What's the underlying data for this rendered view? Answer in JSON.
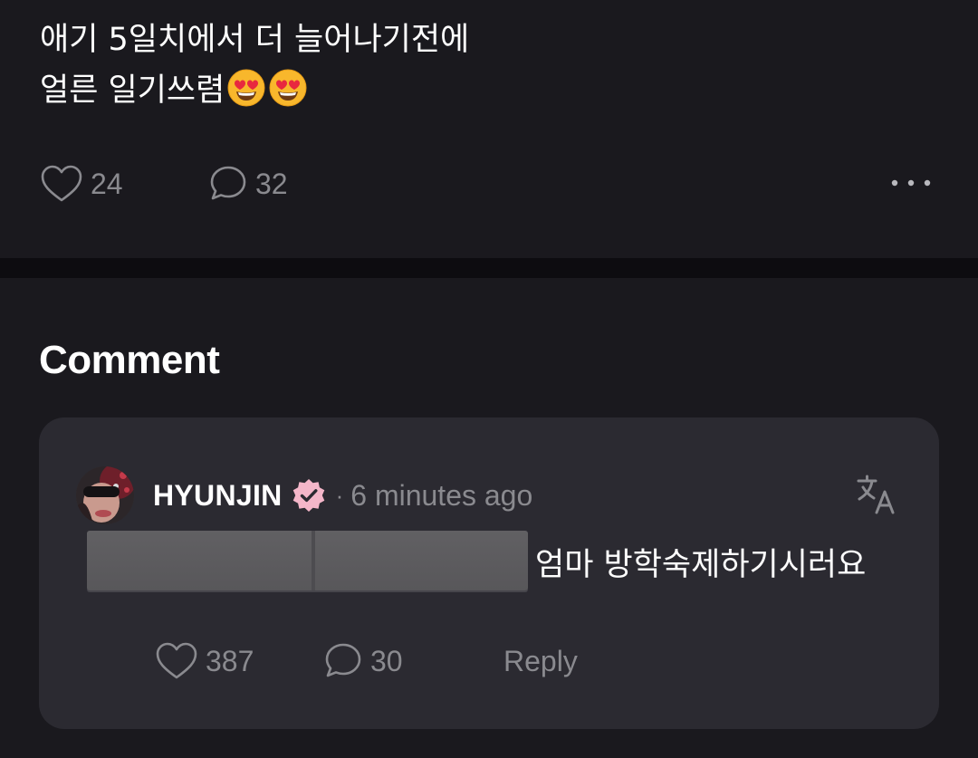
{
  "post": {
    "text_line_1": "애기 5일치에서 더 늘어나기전에",
    "text_line_2": "얼른 일기쓰렴",
    "emojis": [
      "heart-eyes-emoji",
      "heart-eyes-emoji"
    ],
    "like_count": "24",
    "comment_count": "32",
    "icons": {
      "like": "heart-outline-icon",
      "comment": "speech-bubble-icon",
      "more": "more-horizontal-icon"
    }
  },
  "comments_section": {
    "title": "Comment",
    "comment": {
      "author": "HYUNJIN",
      "verified": true,
      "verified_color": "#f4b6c9",
      "separator": "·",
      "timestamp": "6 minutes ago",
      "text": "엄마 방학숙제하기시러요",
      "like_count": "387",
      "reply_count": "30",
      "reply_label": "Reply",
      "icons": {
        "translate": "translate-icon",
        "like": "heart-outline-icon",
        "replies": "speech-bubble-icon"
      }
    }
  },
  "colors": {
    "background": "#1a191e",
    "divider": "#0d0c10",
    "card": "#2b2a31",
    "muted_text": "#8a8a8f",
    "text": "#ffffff"
  }
}
